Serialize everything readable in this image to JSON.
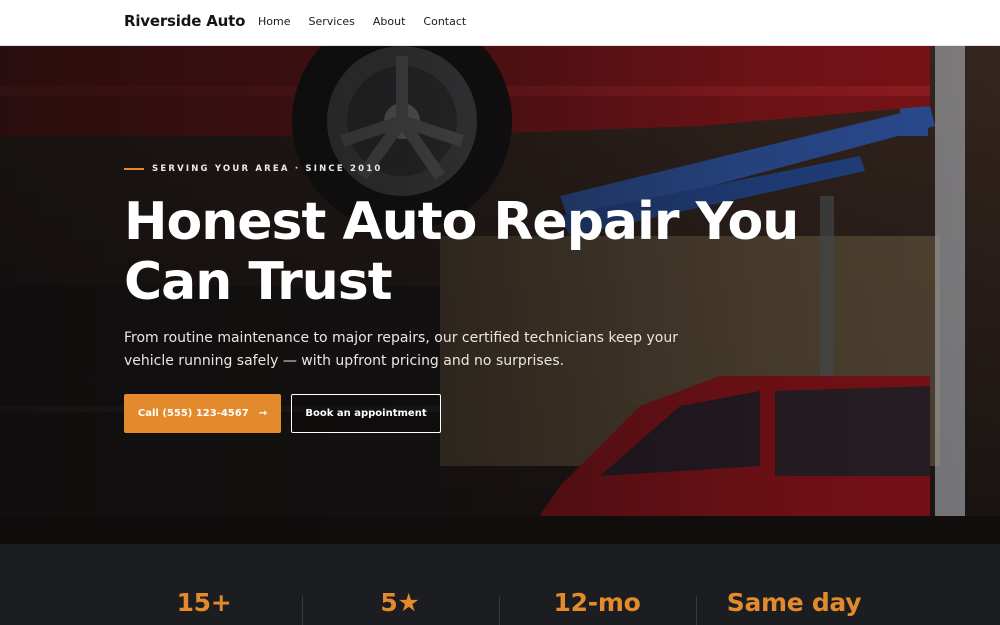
{
  "nav": {
    "brand": "Riverside Auto",
    "links": [
      "Home",
      "Services",
      "About",
      "Contact"
    ]
  },
  "hero": {
    "eyebrow": "SERVING YOUR AREA · SINCE 2010",
    "headline": "Honest Auto Repair You Can Trust",
    "description": "From routine maintenance to major repairs, our certified technicians keep your vehicle running safely — with upfront pricing and no surprises.",
    "primary_button": "Call (555) 123-4567",
    "primary_button_icon": "→",
    "secondary_button": "Book an appointment"
  },
  "stats": {
    "values": [
      "15+",
      "5★",
      "12-mo",
      "Same day"
    ]
  },
  "colors": {
    "accent": "#e28a2c",
    "nav_bg": "#ffffff",
    "stats_bg": "#1c1d21"
  }
}
